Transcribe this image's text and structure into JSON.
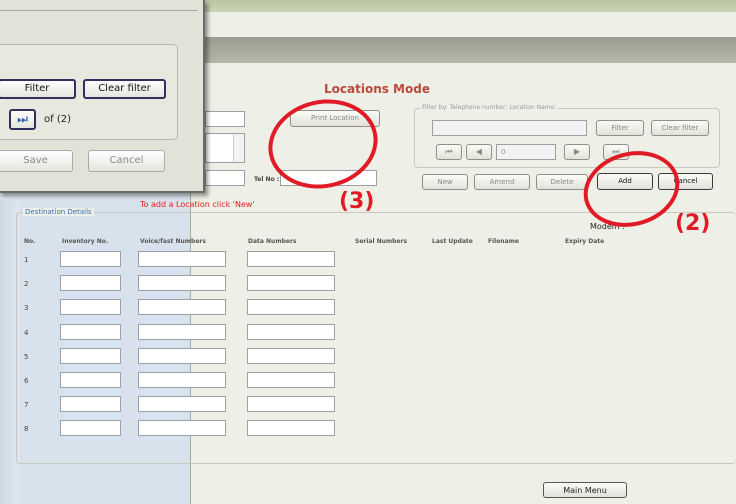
{
  "popup": {
    "filter_label": "Filter",
    "clear_filter_label": "Clear filter",
    "record_of": "of  (2)",
    "save_label": "Save",
    "cancel_label": "Cancel"
  },
  "header": {
    "mode_title": "Locations Mode"
  },
  "location_panel": {
    "print_location_label": "Print Location",
    "tel_label": "Tel No :"
  },
  "filter_group": {
    "title": "Filter by: Telephone number; Location Name;",
    "filter_label": "Filter",
    "clear_filter_label": "Clear filter",
    "record_value": "0"
  },
  "actions": {
    "new_label": "New",
    "amend_label": "Amend",
    "delete_label": "Delete",
    "add_label": "Add",
    "cancel_label": "Cancel"
  },
  "destination": {
    "hint": "To add a Location click 'New'",
    "title": "Destination Details",
    "modem_label": "Modem :",
    "columns": [
      "No.",
      "Inventory No.",
      "Voice/fast Numbers",
      "Data Numbers",
      "Serial Numbers",
      "Last Update",
      "Filename",
      "Expiry Date"
    ],
    "rows": [
      "1",
      "2",
      "3",
      "4",
      "5",
      "6",
      "7",
      "8"
    ]
  },
  "footer": {
    "main_menu_label": "Main Menu"
  },
  "annotations": {
    "label_3": "(3)",
    "label_2": "(2)"
  },
  "colors": {
    "annotation_red": "#e11b25",
    "mode_title": "#b84a3c",
    "hint_red": "#e02020",
    "group_blue": "#3a6fb0"
  }
}
